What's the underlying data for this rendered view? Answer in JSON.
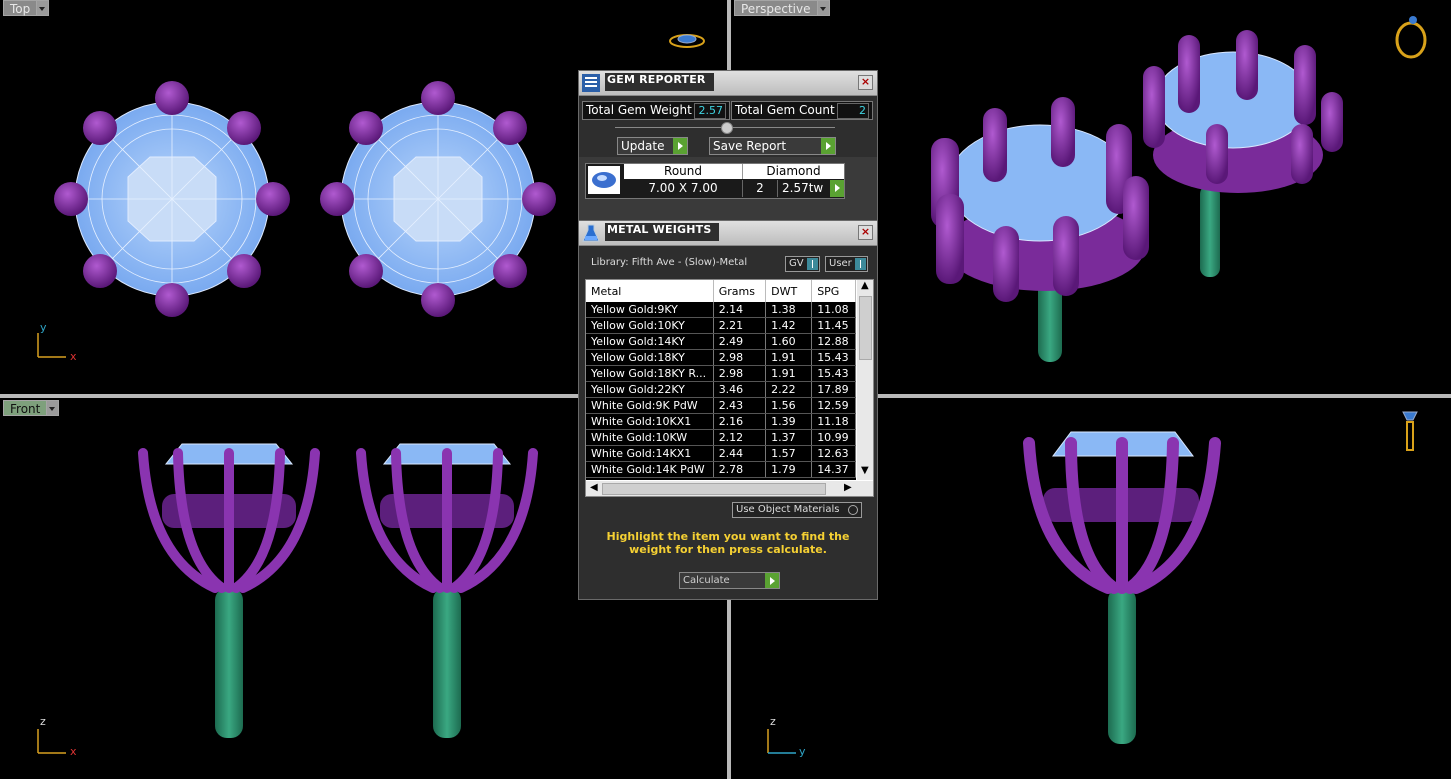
{
  "viewports": {
    "top": {
      "label": "Top"
    },
    "perspective": {
      "label": "Perspective"
    },
    "front": {
      "label": "Front"
    }
  },
  "axes": {
    "top": {
      "v": "y",
      "h": "x"
    },
    "front": {
      "v": "z",
      "h": "x"
    },
    "right": {
      "v": "z",
      "h": "y"
    }
  },
  "colors": {
    "gem": "#8ab8f5",
    "prong": "#7a2b9a",
    "post": "#2a8a68",
    "accent_green": "#5aa232",
    "hint": "#f5d033"
  },
  "gem_reporter": {
    "title": "GEM REPORTER",
    "close": "×",
    "total_weight_label": "Total Gem Weight",
    "total_weight_value": "2.57",
    "total_count_label": "Total Gem Count",
    "total_count_value": "2",
    "update_label": "Update",
    "save_report_label": "Save Report",
    "gem_row": {
      "shape_header": "Round",
      "type_header": "Diamond",
      "size": "7.00 X 7.00",
      "count": "2",
      "weight": "2.57tw"
    }
  },
  "metal_weights": {
    "title": "METAL WEIGHTS",
    "close": "×",
    "library_label": "Library: Fifth Ave - (Slow)-Metal",
    "gv_label": "GV",
    "user_label": "User",
    "columns": [
      "Metal",
      "Grams",
      "DWT",
      "SPG"
    ],
    "rows": [
      [
        "Yellow Gold:9KY",
        "2.14",
        "1.38",
        "11.08"
      ],
      [
        "Yellow Gold:10KY",
        "2.21",
        "1.42",
        "11.45"
      ],
      [
        "Yellow Gold:14KY",
        "2.49",
        "1.60",
        "12.88"
      ],
      [
        "Yellow Gold:18KY",
        "2.98",
        "1.91",
        "15.43"
      ],
      [
        "Yellow Gold:18KY R...",
        "2.98",
        "1.91",
        "15.43"
      ],
      [
        "Yellow Gold:22KY",
        "3.46",
        "2.22",
        "17.89"
      ],
      [
        "White Gold:9K PdW",
        "2.43",
        "1.56",
        "12.59"
      ],
      [
        "White Gold:10KX1",
        "2.16",
        "1.39",
        "11.18"
      ],
      [
        "White Gold:10KW",
        "2.12",
        "1.37",
        "10.99"
      ],
      [
        "White Gold:14KX1",
        "2.44",
        "1.57",
        "12.63"
      ],
      [
        "White Gold:14K PdW",
        "2.78",
        "1.79",
        "14.37"
      ]
    ],
    "use_object_materials_label": "Use Object Materials",
    "hint": "Highlight the item you want to find the weight for then press calculate.",
    "calculate_label": "Calculate"
  }
}
